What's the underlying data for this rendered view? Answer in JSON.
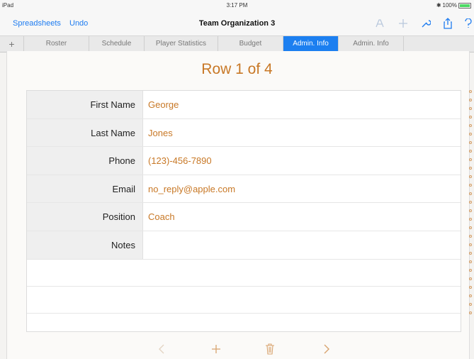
{
  "status_bar": {
    "device": "iPad",
    "time": "3:17 PM",
    "battery": "100%"
  },
  "toolbar": {
    "spreadsheets_label": "Spreadsheets",
    "undo_label": "Undo",
    "document_title": "Team Organization 3"
  },
  "tabs": [
    {
      "label": "Roster"
    },
    {
      "label": "Schedule"
    },
    {
      "label": "Player Statistics"
    },
    {
      "label": "Budget"
    },
    {
      "label": "Admin. Info"
    },
    {
      "label": "Admin. Info"
    }
  ],
  "form": {
    "row_indicator": "Row 1 of 4",
    "fields": [
      {
        "label": "First Name",
        "value": "George"
      },
      {
        "label": "Last Name",
        "value": "Jones"
      },
      {
        "label": "Phone",
        "value": "(123)-456-7890"
      },
      {
        "label": "Email",
        "value": "no_reply@apple.com"
      },
      {
        "label": "Position",
        "value": "Coach"
      },
      {
        "label": "Notes",
        "value": ""
      }
    ]
  },
  "colors": {
    "accent_blue": "#1c7ff0",
    "value_orange": "#c87826"
  },
  "icons": {
    "format": "paintbrush-icon",
    "insert": "plus-icon",
    "tools": "wrench-icon",
    "share": "share-icon",
    "help": "help-icon",
    "prev": "chevron-left-icon",
    "add_row": "plus-icon",
    "delete_row": "trash-icon",
    "next": "chevron-right-icon"
  }
}
